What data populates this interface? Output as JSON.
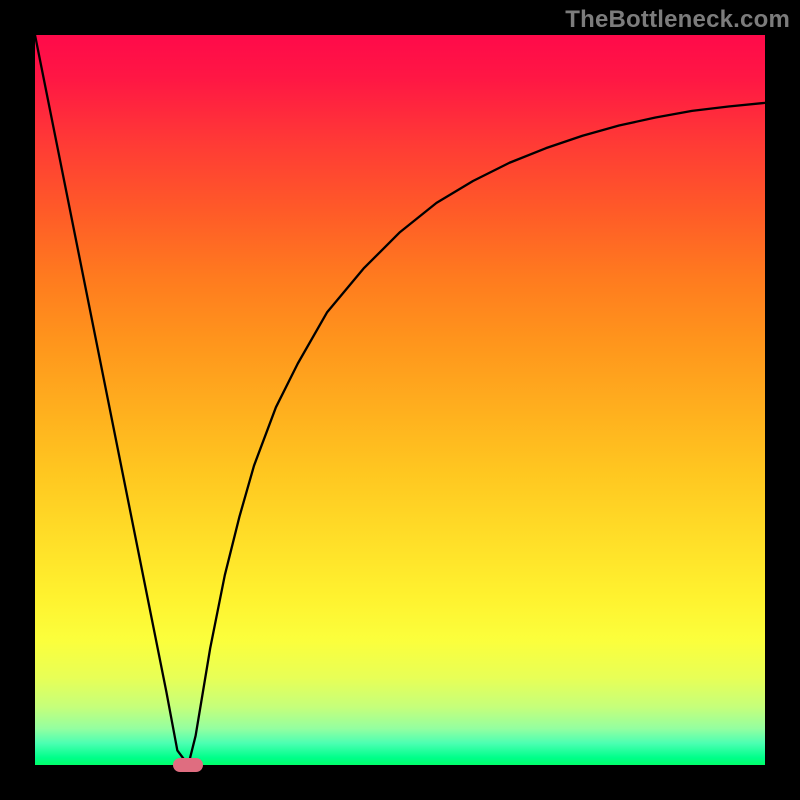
{
  "watermark": "TheBottleneck.com",
  "chart_data": {
    "type": "line",
    "title": "",
    "xlabel": "",
    "ylabel": "",
    "xlim": [
      0,
      100
    ],
    "ylim": [
      0,
      100
    ],
    "grid": false,
    "legend": false,
    "series": [
      {
        "name": "bottleneck-curve",
        "x": [
          0,
          2,
          4,
          6,
          8,
          10,
          12,
          14,
          16,
          18,
          19.5,
          21,
          22,
          23,
          24,
          26,
          28,
          30,
          33,
          36,
          40,
          45,
          50,
          55,
          60,
          65,
          70,
          75,
          80,
          85,
          90,
          95,
          100
        ],
        "y": [
          100,
          90,
          80,
          70,
          60,
          50,
          40,
          30,
          20,
          10,
          2,
          0,
          4,
          10,
          16,
          26,
          34,
          41,
          49,
          55,
          62,
          68,
          73,
          77,
          80,
          82.5,
          84.5,
          86.2,
          87.6,
          88.7,
          89.6,
          90.2,
          90.7
        ]
      }
    ],
    "marker": {
      "x": 21,
      "y": 0,
      "label": "optimal-point"
    },
    "gradient_stops": [
      {
        "pos": 0,
        "color": "#ff0a4a"
      },
      {
        "pos": 50,
        "color": "#ffc720"
      },
      {
        "pos": 85,
        "color": "#fbff3c"
      },
      {
        "pos": 100,
        "color": "#00ff6a"
      }
    ]
  }
}
